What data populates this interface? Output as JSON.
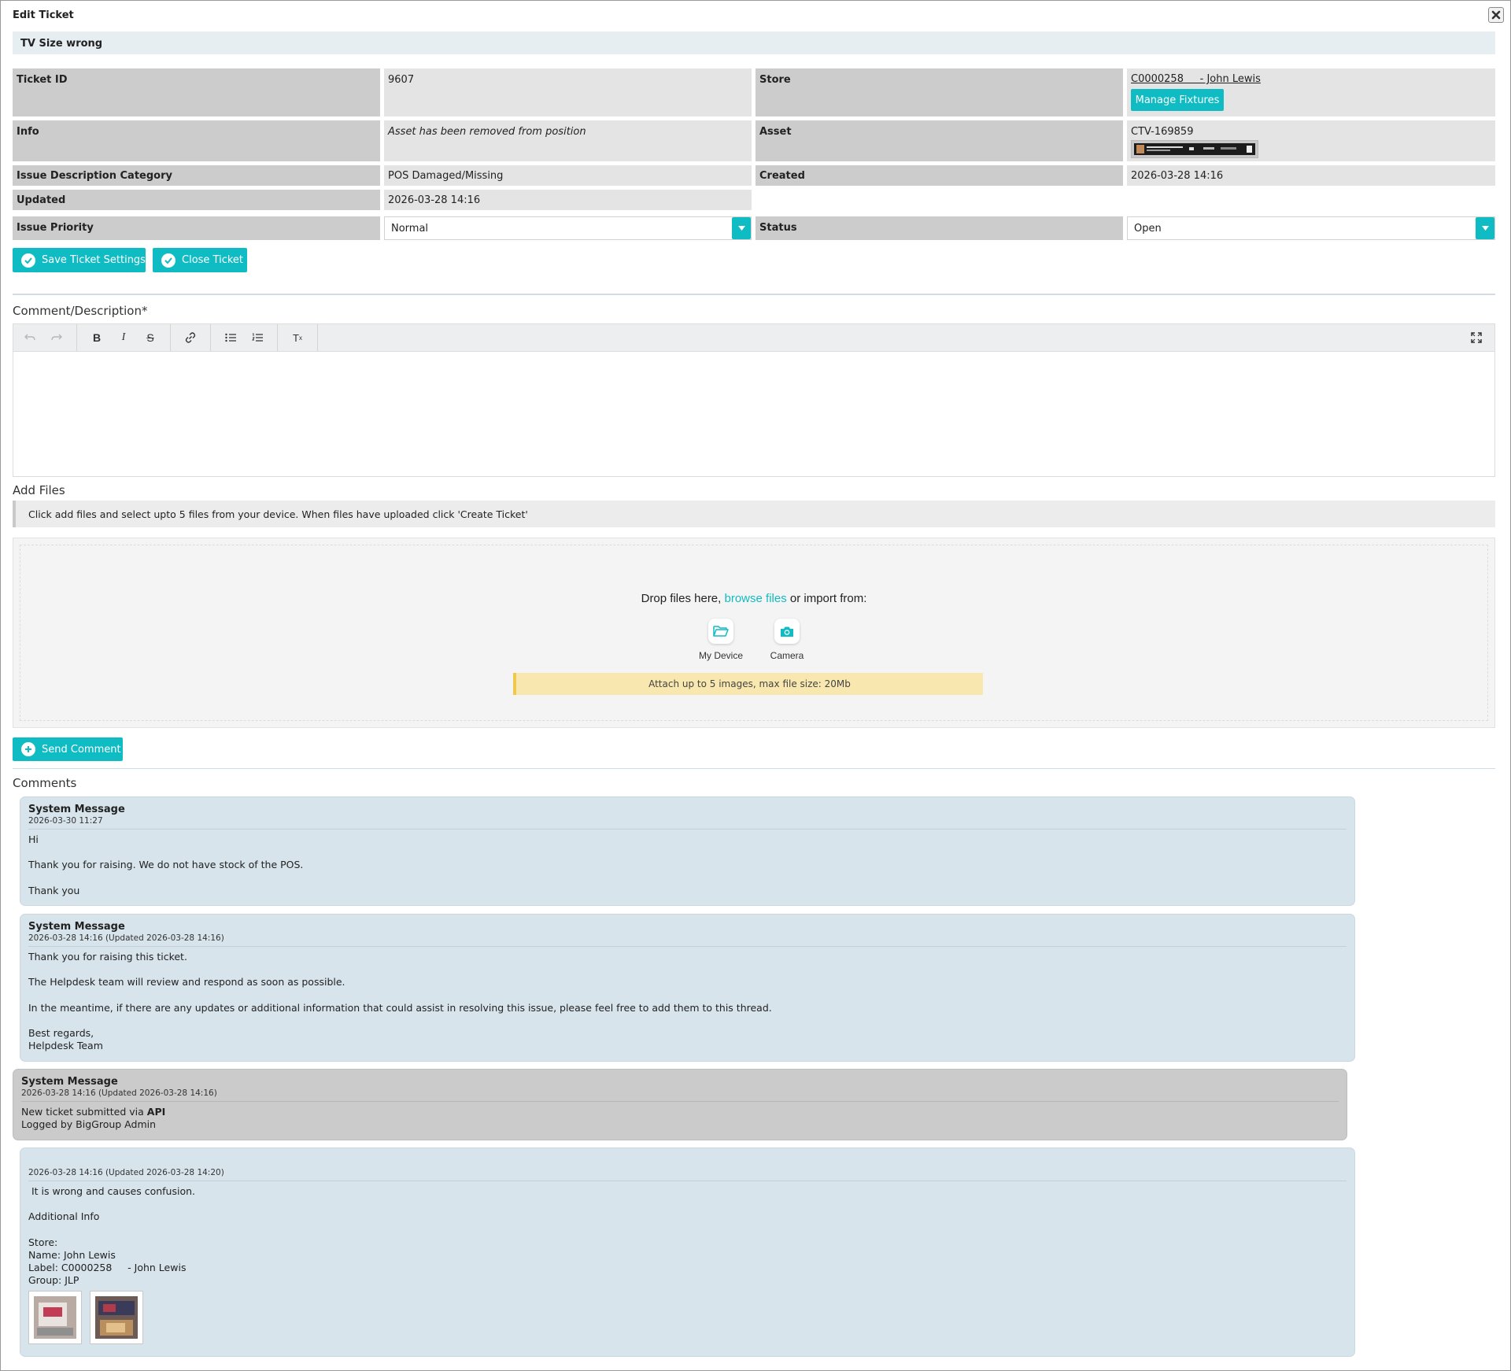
{
  "dialog": {
    "title": "Edit Ticket"
  },
  "ticket": {
    "subject": "TV Size wrong",
    "fields": {
      "ticket_id_label": "Ticket ID",
      "ticket_id": "9607",
      "store_label": "Store",
      "store_value": "C0000258     - John Lewis",
      "manage_fixtures": "Manage Fixtures",
      "info_label": "Info",
      "info_value": "Asset has been removed from position",
      "asset_label": "Asset",
      "asset_value": "CTV-169859",
      "issue_cat_label": "Issue Description Category",
      "issue_cat_value": "POS Damaged/Missing",
      "created_label": "Created",
      "created_value": "2026-03-28 14:16",
      "updated_label": "Updated",
      "updated_value": "2026-03-28 14:16",
      "priority_label": "Issue Priority",
      "priority_value": "Normal",
      "status_label": "Status",
      "status_value": "Open"
    },
    "actions": {
      "save": "Save Ticket Settings",
      "close": "Close Ticket"
    }
  },
  "comment_form": {
    "heading": "Comment/Description*",
    "toolbar": [
      "undo-icon",
      "redo-icon",
      "bold-icon",
      "italic-icon",
      "strikethrough-icon",
      "link-icon",
      "bullet-list-icon",
      "numbered-list-icon",
      "clear-format-icon",
      "fullscreen-icon"
    ],
    "files_heading": "Add Files",
    "files_info": "Click add files and select upto 5 files from your device. When files have uploaded click 'Create Ticket'",
    "drop_prefix": "Drop files here, ",
    "drop_browse": "browse files",
    "drop_suffix": " or import from:",
    "source_device": "My Device",
    "source_camera": "Camera",
    "limit_note": "Attach up to 5 images, max file size: 20Mb",
    "send": "Send Comment"
  },
  "comments": {
    "heading": "Comments",
    "items": [
      {
        "author": "System Message",
        "date": "2026-03-30 11:27",
        "body": "Hi\n\nThank you for raising. We do not have stock of the POS.\n\nThank you"
      },
      {
        "author": "System Message",
        "date": "2026-03-28 14:16 (Updated 2026-03-28 14:16)",
        "body": "Thank you for raising this ticket.\n\nThe Helpdesk team will review and respond as soon as possible.\n\nIn the meantime, if there are any updates or additional information that could assist in resolving this issue, please feel free to add them to this thread.\n\nBest regards,\nHelpdesk Team"
      },
      {
        "author": "System Message",
        "date": "2026-03-28 14:16 (Updated 2026-03-28 14:16)",
        "body_prefix": "New ticket submitted via ",
        "body_bold": "API",
        "body_line2": "Logged by BigGroup Admin"
      },
      {
        "author": "",
        "date": "2026-03-28 14:16 (Updated 2026-03-28 14:20)",
        "body": " It is wrong and causes confusion.\n\nAdditional Info\n\nStore:\nName: John Lewis\nLabel: C0000258     - John Lewis\nGroup: JLP"
      }
    ]
  },
  "colors": {
    "accent": "#10bcc3",
    "comment_blue": "#d7e4eb",
    "comment_grey": "#cbcbcb",
    "label_bg": "#cccccc",
    "value_bg": "#e4e4e4"
  }
}
